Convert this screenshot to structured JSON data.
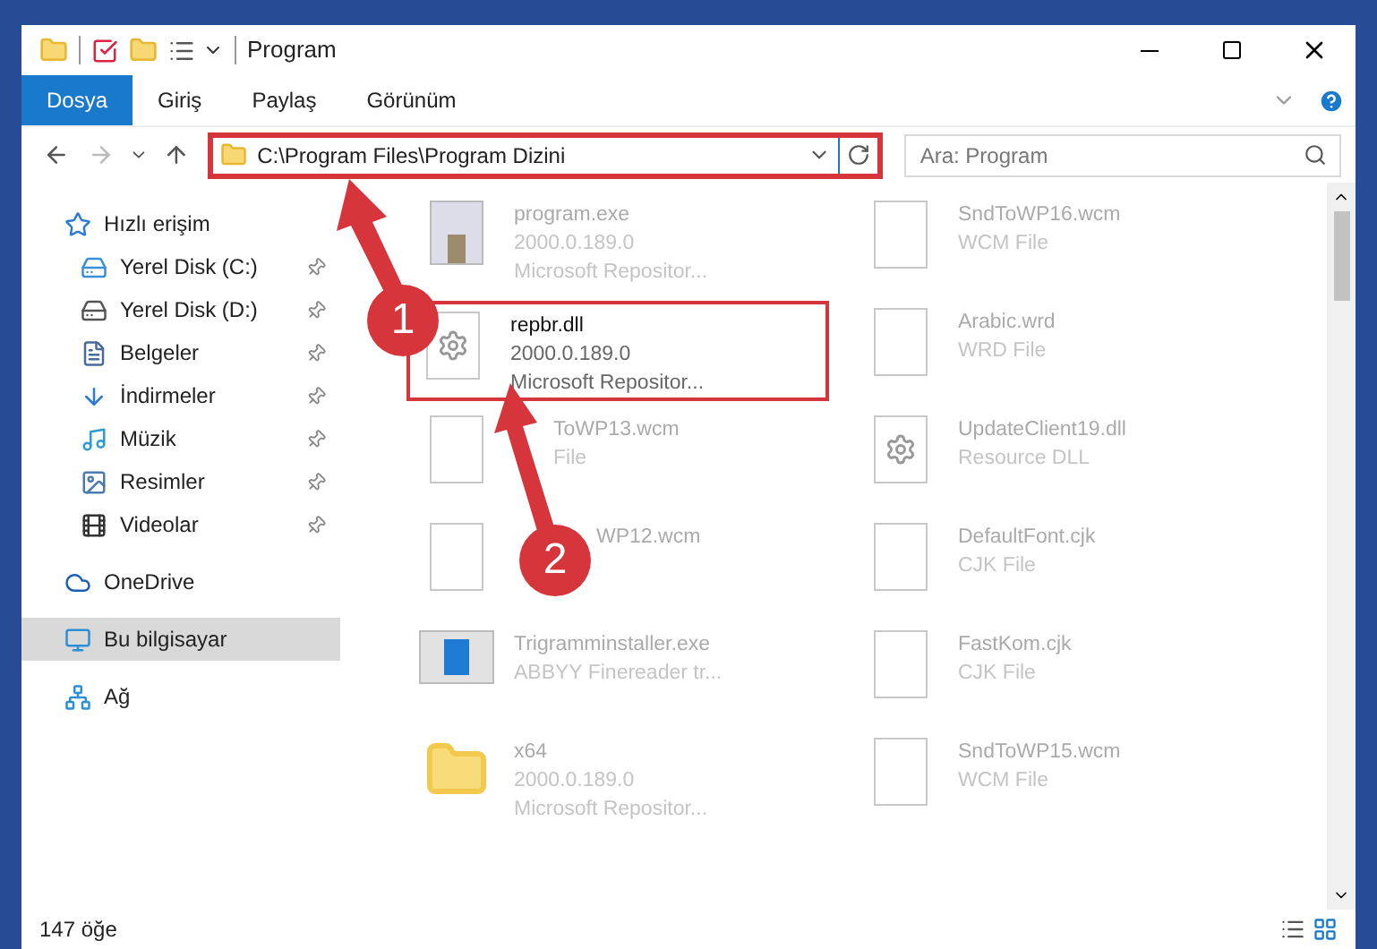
{
  "window": {
    "title": "Program"
  },
  "ribbon_tabs": [
    {
      "label": "Dosya",
      "selected": true
    },
    {
      "label": "Giriş",
      "selected": false
    },
    {
      "label": "Paylaş",
      "selected": false
    },
    {
      "label": "Görünüm",
      "selected": false
    }
  ],
  "address_bar": {
    "path": "C:\\Program Files\\Program Dizini",
    "highlighted": true
  },
  "search": {
    "placeholder": "Ara: Program"
  },
  "sidebar": {
    "items": [
      {
        "label": "Hızlı erişim",
        "kind": "star",
        "selected": false,
        "children": [
          {
            "label": "Yerel Disk (C:)",
            "kind": "disk-c",
            "pinned": true,
            "selected": false
          },
          {
            "label": "Yerel Disk (D:)",
            "kind": "disk",
            "pinned": true,
            "selected": false
          },
          {
            "label": "Belgeler",
            "kind": "docs",
            "pinned": true,
            "selected": false
          },
          {
            "label": "İndirmeler",
            "kind": "download",
            "pinned": true,
            "selected": false
          },
          {
            "label": "Müzik",
            "kind": "music",
            "pinned": true,
            "selected": false
          },
          {
            "label": "Resimler",
            "kind": "pictures",
            "pinned": true,
            "selected": false
          },
          {
            "label": "Videolar",
            "kind": "video",
            "pinned": true,
            "selected": false
          }
        ]
      },
      {
        "label": "OneDrive",
        "kind": "cloud",
        "selected": false
      },
      {
        "label": "Bu bilgisayar",
        "kind": "computer",
        "selected": true
      },
      {
        "label": "Ağ",
        "kind": "network",
        "selected": false
      }
    ]
  },
  "files": [
    {
      "name": "program.exe",
      "details": [
        "2000.0.189.0",
        "Microsoft Repositor..."
      ],
      "kind": "exe",
      "highlighted": false
    },
    {
      "name": "SndToWP16.wcm",
      "details": [
        "WCM File"
      ],
      "kind": "blank",
      "highlighted": false
    },
    {
      "name": "repbr.dll",
      "details": [
        "2000.0.189.0",
        "Microsoft Repositor..."
      ],
      "kind": "dll",
      "highlighted": true
    },
    {
      "name": "Arabic.wrd",
      "details": [
        "WRD File"
      ],
      "kind": "blank",
      "highlighted": false
    },
    {
      "name": "ToWP13.wcm",
      "details": [
        "File"
      ],
      "kind": "blank",
      "highlighted": false
    },
    {
      "name": "UpdateClient19.dll",
      "details": [
        "Resource DLL"
      ],
      "kind": "dll",
      "highlighted": false
    },
    {
      "name": "WP12.wcm",
      "kind": "blank",
      "highlighted": false
    },
    {
      "name": "DefaultFont.cjk",
      "details": [
        "CJK File"
      ],
      "kind": "blank",
      "highlighted": false
    },
    {
      "name": "Trigramminstaller.exe",
      "details": [
        "ABBYY Finereader tr..."
      ],
      "kind": "installer",
      "highlighted": false
    },
    {
      "name": "FastKom.cjk",
      "details": [
        "CJK File"
      ],
      "kind": "blank",
      "highlighted": false
    },
    {
      "name": "x64",
      "details": [
        "2000.0.189.0",
        "Microsoft Repositor..."
      ],
      "kind": "folder",
      "highlighted": false
    },
    {
      "name": "SndToWP15.wcm",
      "details": [
        "WCM File"
      ],
      "kind": "blank",
      "highlighted": false
    }
  ],
  "status_bar": {
    "count": "147 öğe"
  },
  "annotations": [
    {
      "number": "1"
    },
    {
      "number": "2"
    }
  ]
}
